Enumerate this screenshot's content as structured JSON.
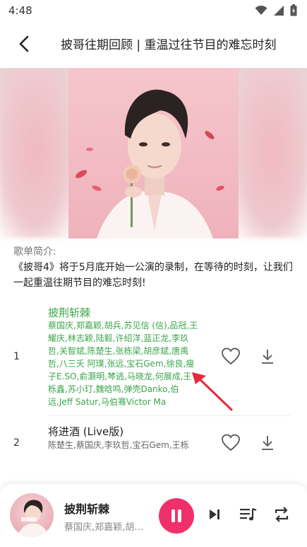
{
  "status": {
    "time": "4:48"
  },
  "header": {
    "title": "披哥往期回顾 | 重温过往节目的难忘时刻"
  },
  "intro": {
    "label": "歌单简介:",
    "text": "《披哥4》将于5月底开始一公演的录制，在等待的时刻，让我们一起重温往期节目的难忘时刻!"
  },
  "songs": [
    {
      "index": "1",
      "title": "披荆斩棘",
      "artists": "蔡国庆,郑嘉颖,胡兵,苏见信 (信),品冠,王耀庆,林志颖,陆毅,许绍洋,蓝正龙,李玖哲,关智斌,陈楚生,张栋梁,胡彦斌,唐禹哲,八三夭 阿璞,张远,宝石Gem,徐良,瘦子E.SO,俞灏明,棽逃,马晓龙,何展成,王栎鑫,苏小玎,魏晗鸣,弹壳Danko,伯远,Jeff Satur,马伯骞Victor Ma"
    },
    {
      "index": "2",
      "title": "将进酒 (Live版)",
      "artists": "陈楚生,蔡国庆,李玖哲,宝石Gem,王栎"
    }
  ],
  "player": {
    "title": "披荆斩棘",
    "artist": "蔡国庆,郑嘉颖,胡兵,苏见信 (信),品冠"
  },
  "colors": {
    "accent_green": "#3aa64a",
    "play_pink": "#f0306a",
    "arrow_red": "#e8283c"
  }
}
